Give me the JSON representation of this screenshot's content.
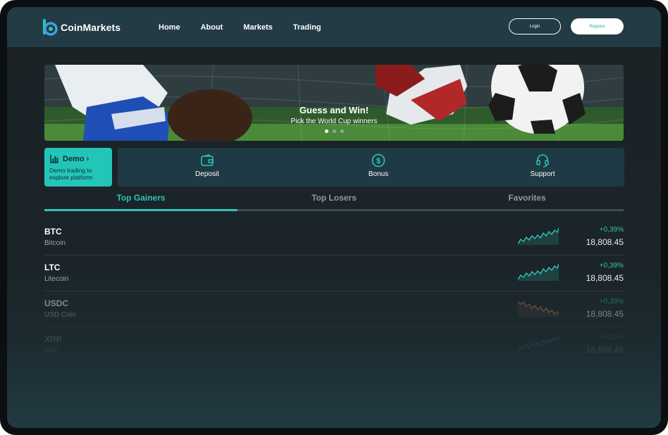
{
  "brand": {
    "name": "CoinMarkets",
    "logo_icon": "coin-b-logo-icon",
    "accent": "#2ec4b6"
  },
  "nav": [
    {
      "label": "Home"
    },
    {
      "label": "About"
    },
    {
      "label": "Markets"
    },
    {
      "label": "Trading"
    }
  ],
  "auth": {
    "login": "Login",
    "register": "Register"
  },
  "banner": {
    "title": "Guess and Win!",
    "subtitle": "Pick the World Cup winners",
    "slides": 3,
    "active_slide": 1
  },
  "demo": {
    "title": "Demo",
    "chevron": "›",
    "description": "Demo trading to explore platform",
    "icon": "bar-chart-icon"
  },
  "actions": [
    {
      "label": "Deposit",
      "icon": "wallet-icon"
    },
    {
      "label": "Bonus",
      "icon": "dollar-coin-icon"
    },
    {
      "label": "Support",
      "icon": "headset-icon"
    }
  ],
  "tabs": [
    {
      "label": "Top Gainers",
      "active": true
    },
    {
      "label": "Top Losers",
      "active": false
    },
    {
      "label": "Favorites",
      "active": false
    }
  ],
  "coins": [
    {
      "symbol": "BTC",
      "name": "Bitcoin",
      "change": "+0,39%",
      "price": "18,808.45",
      "trend": "up",
      "color": "#2ec4b6"
    },
    {
      "symbol": "LTC",
      "name": "Litecoin",
      "change": "+0,39%",
      "price": "18,808.45",
      "trend": "up",
      "color": "#2ec4b6"
    },
    {
      "symbol": "USDC",
      "name": "USD Coin",
      "change": "+0,39%",
      "price": "18,808.45",
      "trend": "down",
      "color": "#c8775e"
    },
    {
      "symbol": "XRP",
      "name": "XRP",
      "change": "+0,39%",
      "price": "18,808.45",
      "trend": "up",
      "color": "#2ec4b6"
    }
  ]
}
